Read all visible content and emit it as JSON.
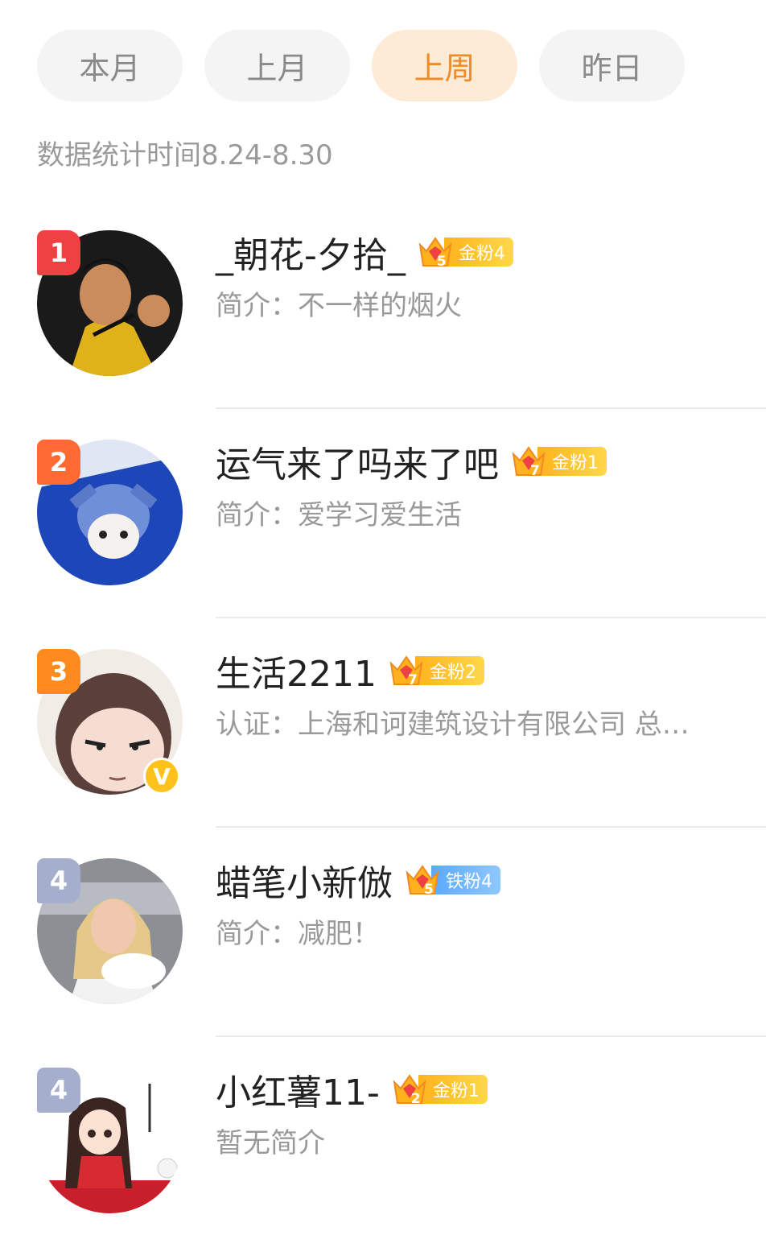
{
  "tabs": [
    {
      "label": "本月",
      "active": false
    },
    {
      "label": "上月",
      "active": false
    },
    {
      "label": "上周",
      "active": true
    },
    {
      "label": "昨日",
      "active": false
    }
  ],
  "period": "数据统计时间8.24-8.30",
  "fans": [
    {
      "rank": "1",
      "name": "_朝花-夕拾_",
      "badge": {
        "type": "金粉4",
        "level": "5",
        "color": "gold"
      },
      "bio": "简介：不一样的烟火",
      "verified": false
    },
    {
      "rank": "2",
      "name": "运气来了吗来了吧",
      "badge": {
        "type": "金粉1",
        "level": "7",
        "color": "gold"
      },
      "bio": "简介：爱学习爱生活",
      "verified": false
    },
    {
      "rank": "3",
      "name": "生活2211",
      "badge": {
        "type": "金粉2",
        "level": "7",
        "color": "gold"
      },
      "bio": "认证：上海和诃建筑设计有限公司 总…",
      "verified": true
    },
    {
      "rank": "4",
      "name": "蜡笔小新倣",
      "badge": {
        "type": "铁粉4",
        "level": "5",
        "color": "iron"
      },
      "bio": "简介：减肥！",
      "verified": false
    },
    {
      "rank": "4",
      "name": "小红薯11-",
      "badge": {
        "type": "金粉1",
        "level": "2",
        "color": "gold"
      },
      "bio": "暂无简介",
      "verified": false
    }
  ],
  "colors": {
    "accent": "#f08a24",
    "gold_badge": "#ffb21c",
    "iron_badge": "#5aa9ff",
    "rank1": "#f04142",
    "rank2": "#ff6a32",
    "rank3": "#ff8a1e",
    "rank4": "#a5aecd"
  }
}
